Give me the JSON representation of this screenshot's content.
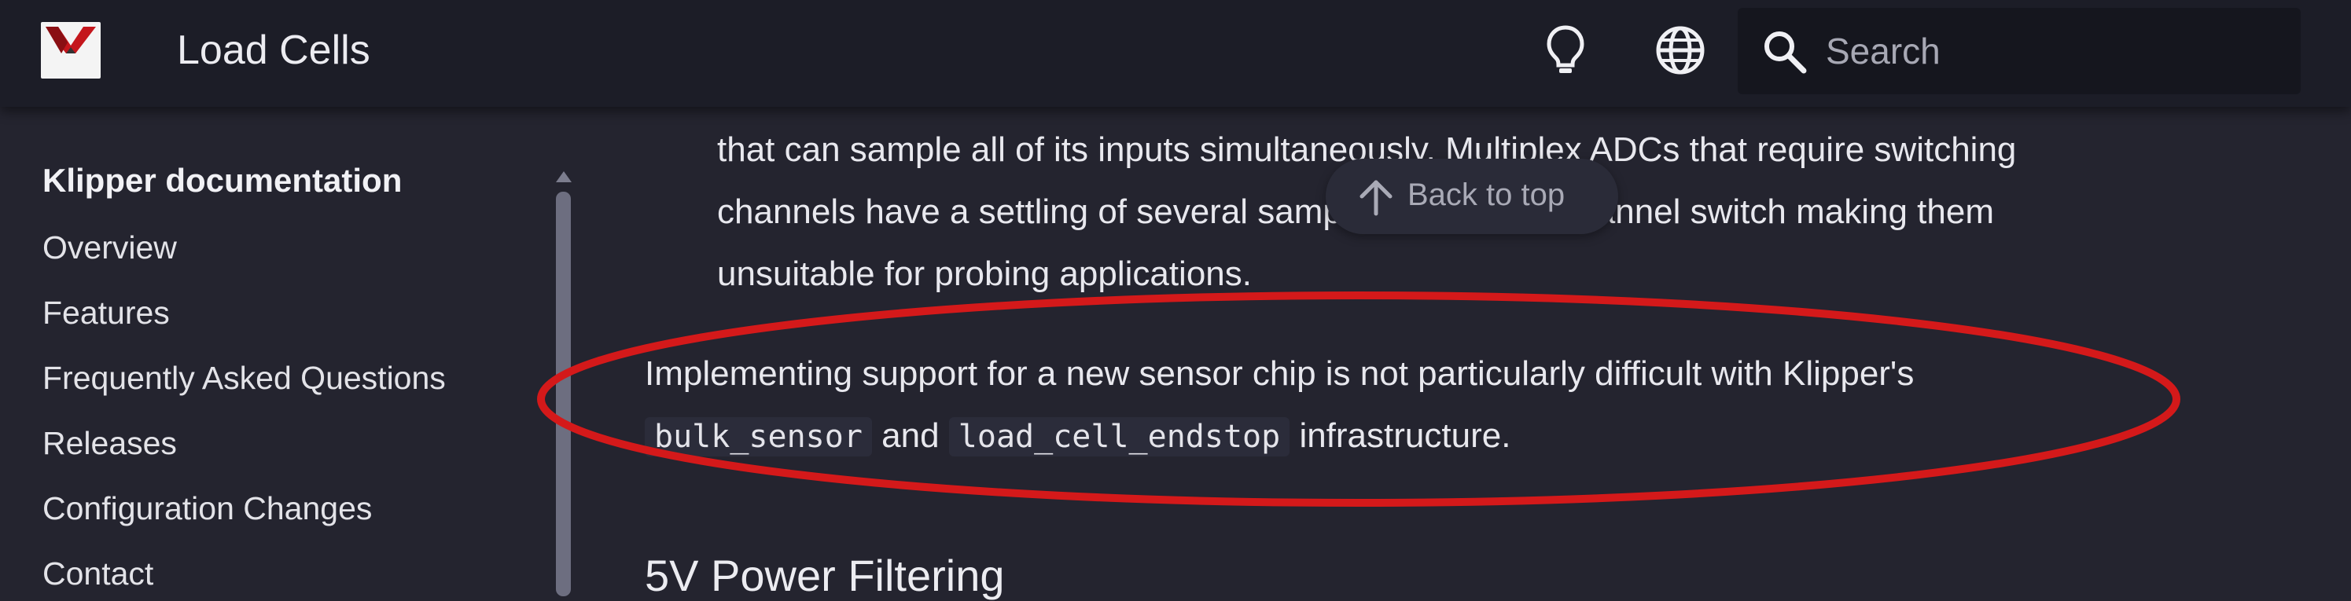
{
  "header": {
    "logo_text": "Klipper",
    "title": "Load Cells",
    "theme_icon": "lightbulb-icon",
    "language_icon": "globe-icon",
    "search": {
      "icon": "search-icon",
      "placeholder": "Search",
      "value": ""
    }
  },
  "sidebar": {
    "title": "Klipper documentation",
    "items": [
      {
        "label": "Overview"
      },
      {
        "label": "Features"
      },
      {
        "label": "Frequently Asked Questions"
      },
      {
        "label": "Releases"
      },
      {
        "label": "Configuration Changes"
      },
      {
        "label": "Contact"
      }
    ]
  },
  "content": {
    "bullet_lines": [
      "that can sample all of its inputs simultaneously. Multiplex ADCs that require switching",
      "channels have a settling of several samples after each channel switch making them",
      "unsuitable for probing applications."
    ],
    "para": {
      "line1": "Implementing support for a new sensor chip is not particularly difficult with Klipper's",
      "code1": "bulk_sensor",
      "and": "and",
      "code2": "load_cell_endstop",
      "tail": "infrastructure."
    },
    "heading": "5V Power Filtering"
  },
  "back_to_top": {
    "label": "Back to top",
    "icon": "arrow-up-icon"
  },
  "colors": {
    "background": "#24242f",
    "header": "#1c1d27",
    "annotation": "#d4191a"
  }
}
